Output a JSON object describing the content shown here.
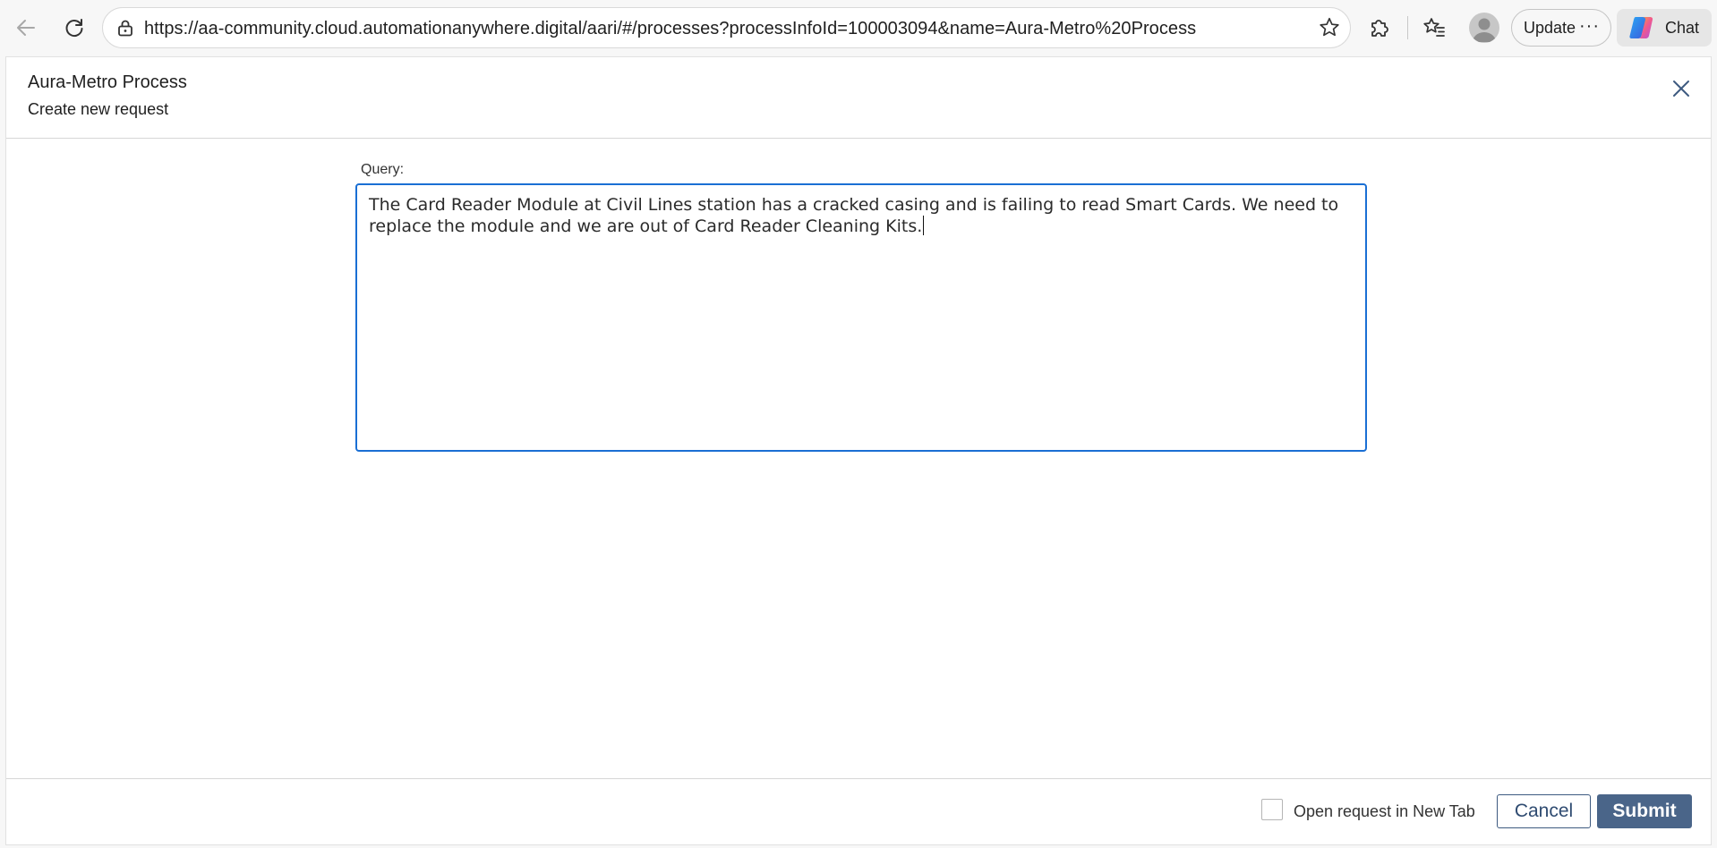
{
  "browser": {
    "url": "https://aa-community.cloud.automationanywhere.digital/aari/#/processes?processInfoId=100003094&name=Aura-Metro%20Process",
    "update_label": "Update",
    "update_menu_glyph": "···",
    "chat_label": "Chat",
    "icons": {
      "back": "back-arrow-icon",
      "refresh": "refresh-icon",
      "lock": "lock-icon",
      "favorite": "star-icon",
      "extensions": "puzzle-icon",
      "favorites_list": "favorites-icon",
      "profile": "avatar",
      "copilot": "copilot-logo-icon"
    }
  },
  "modal": {
    "title": "Aura-Metro Process",
    "subtitle": "Create new request",
    "close_icon": "close-icon",
    "query": {
      "label": "Query:",
      "value": "The Card Reader Module at Civil Lines station has a cracked casing and is failing to read Smart Cards. We need to replace the module and we are out of Card Reader Cleaning Kits."
    },
    "footer": {
      "open_new_tab_label": "Open request in New Tab",
      "open_new_tab_checked": false,
      "cancel_label": "Cancel",
      "submit_label": "Submit"
    }
  },
  "colors": {
    "focus_border": "#1a6fd4",
    "primary_button": "#4a6589",
    "secondary_button_border": "#3d5a80"
  }
}
